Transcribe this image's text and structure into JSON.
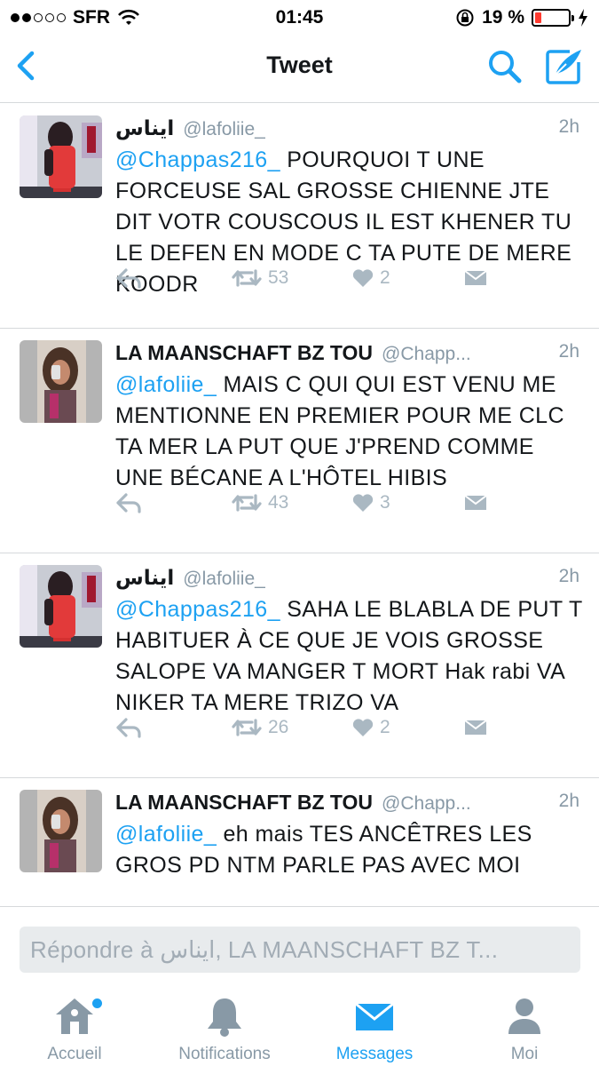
{
  "status_bar": {
    "carrier": "SFR",
    "time": "01:45",
    "battery": "19 %",
    "battery_level": 0.19
  },
  "nav": {
    "title": "Tweet",
    "back_icon": "chevron-left-icon",
    "search_icon": "search-icon",
    "compose_icon": "compose-icon",
    "accent": "#1da1f2"
  },
  "tweets": [
    {
      "name": "ايناس",
      "handle": "@lafoliie_",
      "time": "2h",
      "mention": "@Chappas216_",
      "text": " POURQUOI T UNE FORCEUSE SAL GROSSE CHIENNE JTE DIT VOTR COUSCOUS IL EST KHENER TU LE DEFEN EN MODE C TA PUTE DE MERE KOODR",
      "retweets": "53",
      "likes": "2"
    },
    {
      "name": "LA MAANSCHAFT BZ TOU",
      "handle": "@Chapp...",
      "time": "2h",
      "mention": "@lafoliie_",
      "text": " MAIS C QUI QUI EST VENU ME MENTIONNE EN PREMIER POUR ME CLC TA MER LA PUT QUE J'PREND COMME UNE BÉCANE A L'HÔTEL HIBIS",
      "retweets": "43",
      "likes": "3"
    },
    {
      "name": "ايناس",
      "handle": "@lafoliie_",
      "time": "2h",
      "mention": "@Chappas216_",
      "text": " SAHA LE BLABLA DE PUT T HABITUER À CE QUE JE VOIS GROSSE SALOPE VA MANGER T MORT Hak rabi VA NIKER TA MERE TRIZO VA",
      "retweets": "26",
      "likes": "2"
    },
    {
      "name": "LA MAANSCHAFT BZ TOU",
      "handle": "@Chapp...",
      "time": "2h",
      "mention": "@lafoliie_",
      "text": " eh mais TES ANCÊTRES LES GROS PD NTM PARLE PAS AVEC MOI"
    }
  ],
  "reply": {
    "placeholder": "Répondre à ايناس, LA MAANSCHAFT BZ T..."
  },
  "tabs": [
    {
      "label": "Accueil",
      "icon": "home-icon"
    },
    {
      "label": "Notifications",
      "icon": "bell-icon"
    },
    {
      "label": "Messages",
      "icon": "envelope-icon",
      "active": true
    },
    {
      "label": "Moi",
      "icon": "person-icon"
    }
  ]
}
